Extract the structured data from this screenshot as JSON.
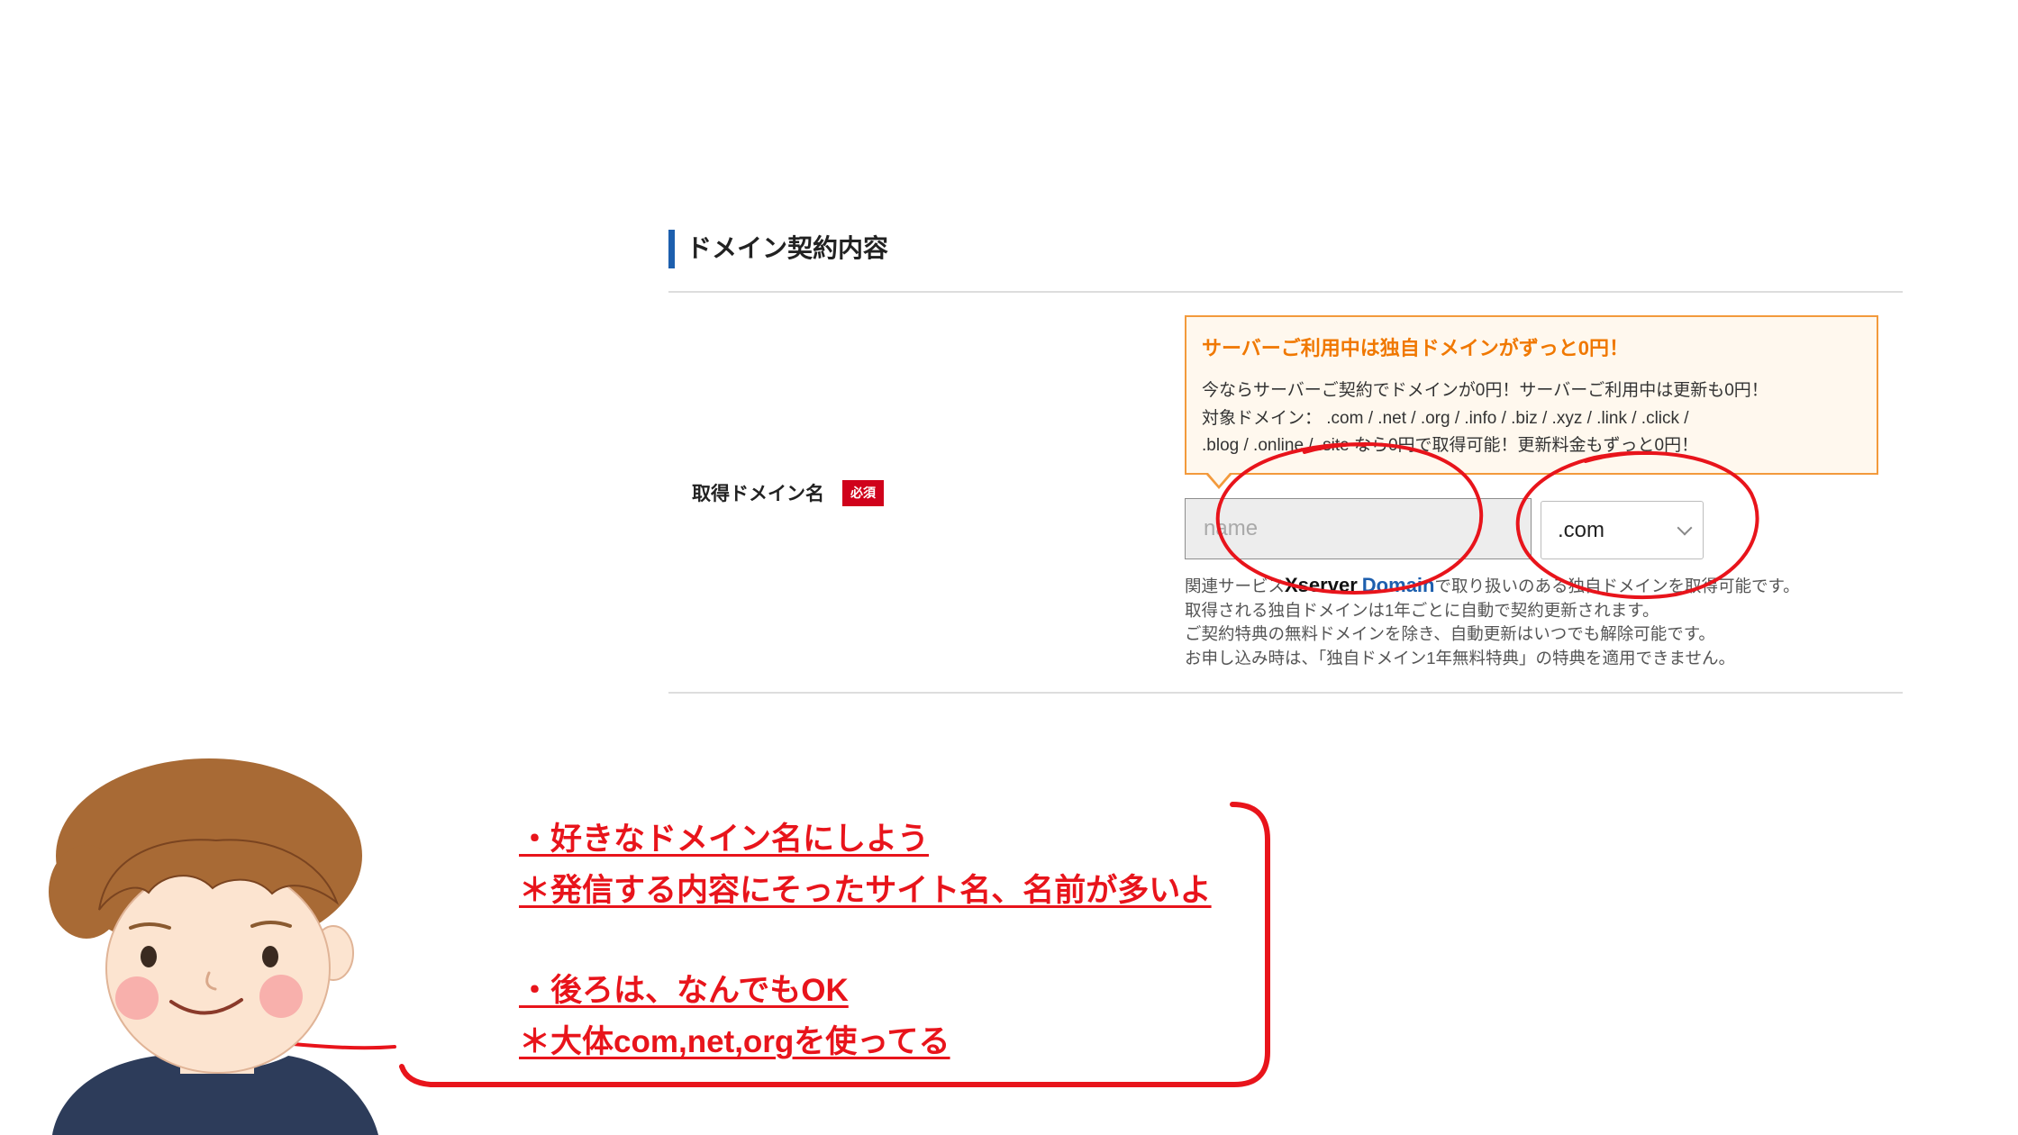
{
  "section": {
    "title": "ドメイン契約内容"
  },
  "field": {
    "label": "取得ドメイン名",
    "required_badge": "必須"
  },
  "notice": {
    "title": "サーバーご利用中は独自ドメインがずっと0円！",
    "lines": [
      "今ならサーバーご契約でドメインが0円！サーバーご利用中は更新も0円！",
      "対象ドメイン： .com / .net / .org / .info / .biz / .xyz / .link / .click /",
      ".blog / .online / .site なら0円で取得可能！更新料金もずっと0円！"
    ]
  },
  "domain_input": {
    "placeholder": "name"
  },
  "tld_select": {
    "selected": ".com",
    "icon": "chevron-down-icon"
  },
  "help": {
    "service_prefix": "関連サービス",
    "brand_xserver": "Xserver",
    "brand_domain": "Domain",
    "service_suffix": "で取り扱いのある独自ドメインを取得可能です。",
    "lines": [
      "取得される独自ドメインは1年ごとに自動で契約更新されます。",
      "ご契約特典の無料ドメインを除き、自動更新はいつでも解除可能です。",
      "お申し込み時は、「独自ドメイン1年無料特典」の特典を適用できません。"
    ]
  },
  "annotation": {
    "bubble": [
      {
        "point": "・好きなドメイン名にしよう",
        "note": "＊発信する内容にそったサイト名、名前が多いよ"
      },
      {
        "point": "・後ろは、なんでもOK",
        "note": "＊大体com,net,orgを使ってる"
      }
    ],
    "illustration": "boy-avatar"
  },
  "colors": {
    "accent": "#1d5fae",
    "notice-border": "#f39a3c",
    "notice-title": "#f07800",
    "notice-bg": "#fff8ee",
    "badge": "#d0021b",
    "annotation": "#e8141b"
  }
}
